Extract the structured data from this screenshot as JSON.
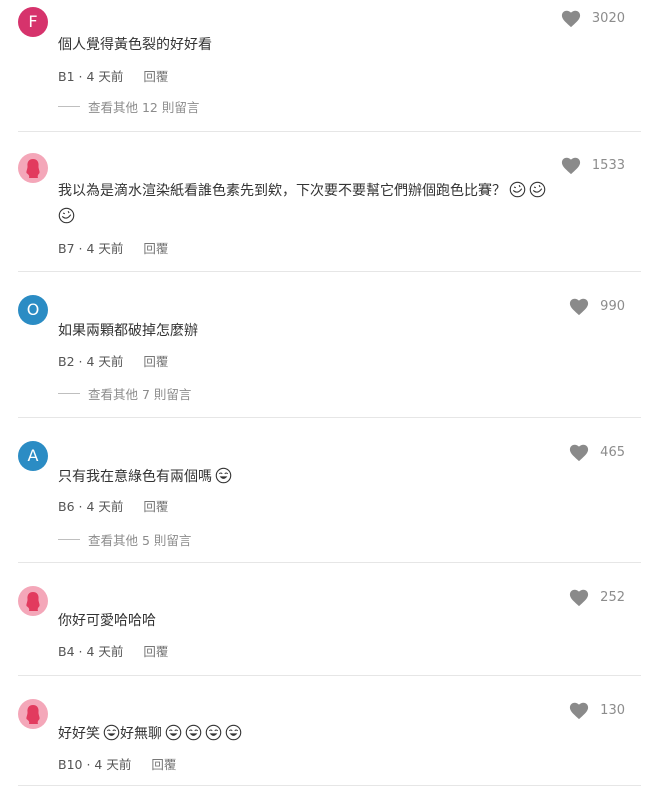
{
  "comments": [
    {
      "avatar_letter": "F",
      "avatar_color": "#d6336c",
      "text": "個人覺得黃色裂的好好看",
      "floor": "B1",
      "time": "4 天前",
      "reply": "回覆",
      "likes": "3020",
      "more_replies": "查看其他 12 則留言",
      "emoji": []
    },
    {
      "avatar_letter": "",
      "avatar_color": "#f4a7b9",
      "text": "我以為是滴水渲染紙看誰色素先到欸，下次要不要幫它們辦個跑色比賽？",
      "floor": "B7",
      "time": "4 天前",
      "reply": "回覆",
      "likes": "1533",
      "more_replies": "",
      "emoji": [
        "rofl",
        "rofl",
        "rofl"
      ]
    },
    {
      "avatar_letter": "O",
      "avatar_color": "#2b8cc4",
      "text": "如果兩顆都破掉怎麼辦",
      "floor": "B2",
      "time": "4 天前",
      "reply": "回覆",
      "likes": "990",
      "more_replies": "查看其他 7 則留言",
      "emoji": []
    },
    {
      "avatar_letter": "A",
      "avatar_color": "#2b8cc4",
      "text": "只有我在意綠色有兩個嗎",
      "floor": "B6",
      "time": "4 天前",
      "reply": "回覆",
      "likes": "465",
      "more_replies": "查看其他 5 則留言",
      "emoji": [
        "joy"
      ]
    },
    {
      "avatar_letter": "",
      "avatar_color": "#f4a7b9",
      "text": "你好可愛哈哈哈",
      "floor": "B4",
      "time": "4 天前",
      "reply": "回覆",
      "likes": "252",
      "more_replies": "",
      "emoji": []
    },
    {
      "avatar_letter": "",
      "avatar_color": "#f4a7b9",
      "text": "好好笑",
      "text2": "好無聊",
      "floor": "B10",
      "time": "4 天前",
      "reply": "回覆",
      "likes": "130",
      "more_replies": "",
      "emoji": [
        "joy",
        "joy",
        "joy",
        "joy",
        "joy"
      ]
    }
  ],
  "colors": {
    "heart": "#8a8a8a",
    "divider": "#e6e6e6"
  },
  "icons": {
    "like": "heart-icon",
    "avatar_default": "female-silhouette-icon",
    "emoji_rofl": "rolling-laughing-emoji-icon",
    "emoji_joy": "tears-of-joy-emoji-icon"
  }
}
